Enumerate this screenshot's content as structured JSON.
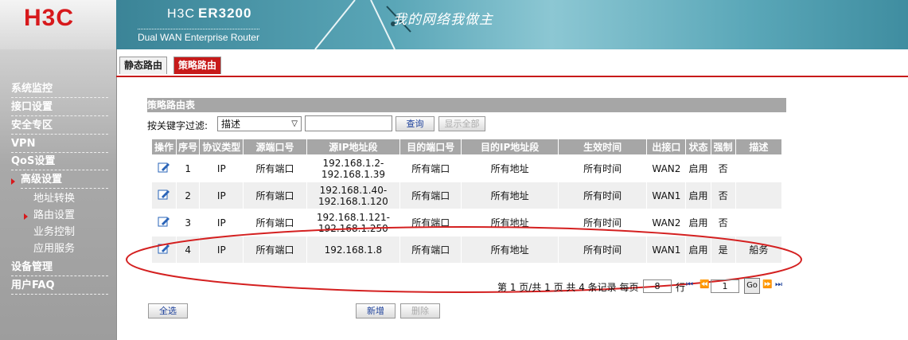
{
  "header": {
    "logo": "H3C",
    "product_brand": "H3C",
    "product_model": "ER3200",
    "product_subtitle": "Dual WAN Enterprise Router",
    "slogan": "我的网络我做主"
  },
  "nav": {
    "items": [
      {
        "label": "系统监控"
      },
      {
        "label": "接口设置"
      },
      {
        "label": "安全专区"
      },
      {
        "label": "VPN"
      },
      {
        "label": "QoS设置"
      },
      {
        "label": "高级设置"
      },
      {
        "label": "设备管理"
      },
      {
        "label": "用户FAQ"
      }
    ],
    "sub_items": [
      {
        "label": "地址转换"
      },
      {
        "label": "路由设置"
      },
      {
        "label": "业务控制"
      },
      {
        "label": "应用服务"
      }
    ]
  },
  "tabs": [
    {
      "label": "静态路由"
    },
    {
      "label": "策略路由"
    }
  ],
  "section": {
    "title": "策略路由表",
    "filter_label": "按关键字过滤:",
    "filter_select_value": "描述",
    "keyword_value": "",
    "search_button": "查询",
    "show_all_button": "显示全部"
  },
  "table": {
    "headers": [
      "操作",
      "序号",
      "协议类型",
      "源端口号",
      "源IP地址段",
      "目的端口号",
      "目的IP地址段",
      "生效时间",
      "出接口",
      "状态",
      "强制",
      "描述"
    ],
    "rows": [
      {
        "seq": "1",
        "protocol": "IP",
        "src_port": "所有端口",
        "src_ip_1": "192.168.1.2-",
        "src_ip_2": "192.168.1.39",
        "dst_port": "所有端口",
        "dst_ip": "所有地址",
        "time": "所有时间",
        "out_if": "WAN2",
        "status": "启用",
        "force": "否",
        "desc": ""
      },
      {
        "seq": "2",
        "protocol": "IP",
        "src_port": "所有端口",
        "src_ip_1": "192.168.1.40-",
        "src_ip_2": "192.168.1.120",
        "dst_port": "所有端口",
        "dst_ip": "所有地址",
        "time": "所有时间",
        "out_if": "WAN1",
        "status": "启用",
        "force": "否",
        "desc": ""
      },
      {
        "seq": "3",
        "protocol": "IP",
        "src_port": "所有端口",
        "src_ip_1": "192.168.1.121-",
        "src_ip_2": "192.168.1.250",
        "dst_port": "所有端口",
        "dst_ip": "所有地址",
        "time": "所有时间",
        "out_if": "WAN2",
        "status": "启用",
        "force": "否",
        "desc": ""
      },
      {
        "seq": "4",
        "protocol": "IP",
        "src_port": "所有端口",
        "src_ip_1": "192.168.1.8",
        "src_ip_2": "",
        "dst_port": "所有端口",
        "dst_ip": "所有地址",
        "time": "所有时间",
        "out_if": "WAN1",
        "status": "启用",
        "force": "是",
        "desc": "船务"
      }
    ]
  },
  "pager": {
    "summary": "第 1 页/共 1 页 共 4 条记录 每页",
    "per_page": "8",
    "rows_suffix": "行",
    "current_page": "1",
    "go_label": "Go",
    "first": "⏮",
    "prev": "⏪",
    "next": "⏩",
    "last": "⏭"
  },
  "actions": {
    "select_all": "全选",
    "add": "新增",
    "delete": "删除"
  },
  "colors": {
    "accent_red": "#c71a1a",
    "annotation_red": "#d42020",
    "banner_teal": "#5aa6b7",
    "header_gray": "#a6a6a6"
  },
  "icons": {
    "edit": "edit-icon"
  }
}
